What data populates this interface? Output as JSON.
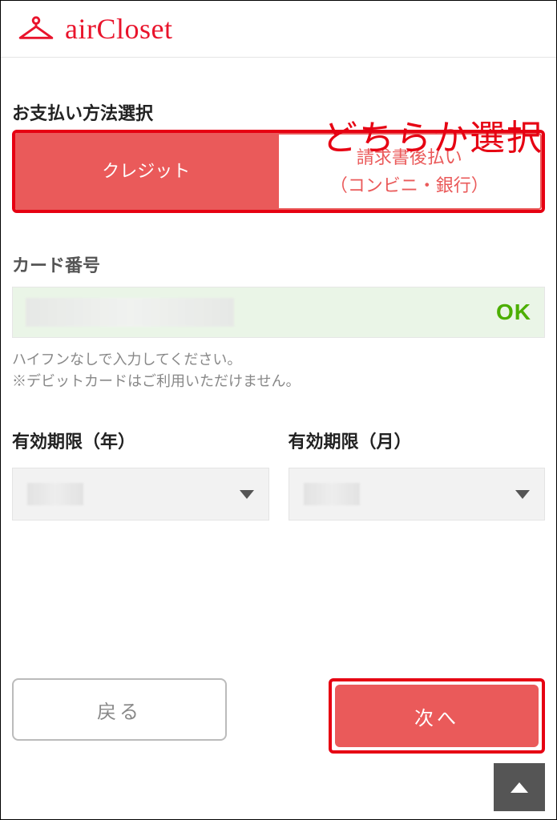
{
  "brand": {
    "name": "airCloset"
  },
  "annotation": "どちらか選択",
  "payment_method": {
    "title": "お支払い方法選択",
    "credit_label": "クレジット",
    "invoice_label_line1": "請求書後払い",
    "invoice_label_line2": "（コンビニ・銀行）"
  },
  "card": {
    "label": "カード番号",
    "ok_badge": "OK",
    "hint_line1": "ハイフンなしで入力してください。",
    "hint_line2": "※デビットカードはご利用いただけません。"
  },
  "expiry": {
    "year_label": "有効期限（年）",
    "month_label": "有効期限（月）"
  },
  "buttons": {
    "back": "戻る",
    "next": "次へ"
  }
}
